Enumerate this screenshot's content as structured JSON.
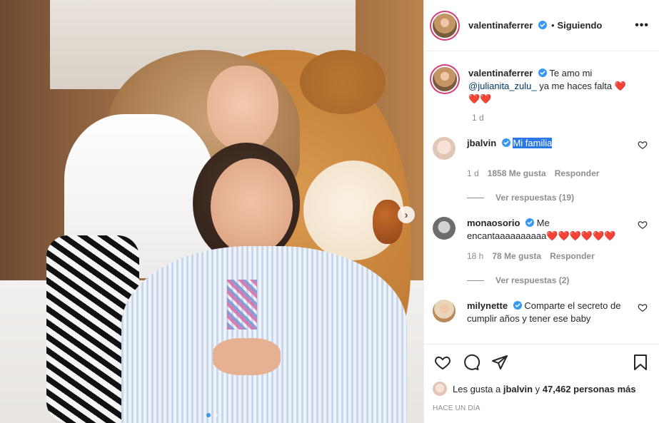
{
  "post": {
    "user": "valentinaferrer",
    "follow_sep": "•",
    "follow_label": "Siguiendo",
    "more_label": "•••",
    "next_label": "›"
  },
  "caption": {
    "user": "valentinaferrer",
    "text_before": "Te amo mi",
    "mention": "@julianita_zulu_",
    "text_after": "ya me haces falta",
    "hearts": "❤️❤️❤️",
    "time": "1 d"
  },
  "comments": [
    {
      "user": "jbalvin",
      "text": "Mi familia",
      "time": "1 d",
      "likes": "1858 Me gusta",
      "reply": "Responder",
      "replies": "Ver respuestas (19)"
    },
    {
      "user": "monaosorio",
      "text": "Me encantaaaaaaaaaa",
      "hearts": "❤️❤️❤️❤️❤️❤️",
      "time": "18 h",
      "likes": "78 Me gusta",
      "reply": "Responder",
      "replies": "Ver respuestas (2)"
    },
    {
      "user": "milynette",
      "text": "Comparte el secreto de cumplir años y tener ese baby"
    }
  ],
  "footer": {
    "likes_prefix": "Les gusta a",
    "likes_user": "jbalvin",
    "likes_mid": "y",
    "likes_count": "47,462 personas más",
    "posted": "Hace un día"
  },
  "colors": {
    "verified": "#3897f0",
    "accent": "#3897f0",
    "heart": "#ed4956"
  }
}
